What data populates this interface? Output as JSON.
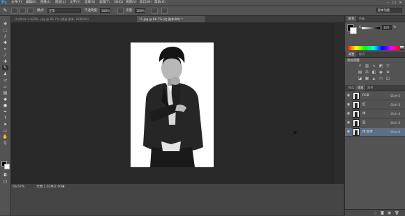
{
  "app": {
    "logo": "Ps"
  },
  "menu": {
    "items": [
      "文件(F)",
      "编辑(E)",
      "图像(I)",
      "图层(L)",
      "文字(Y)",
      "选择(S)",
      "滤镜(T)",
      "3D(D)",
      "视图(V)",
      "窗口(W)",
      "帮助(H)"
    ],
    "window_controls": [
      "–",
      "□",
      "✕"
    ]
  },
  "options_bar": {
    "mode_label": "模式:",
    "mode_value": "正常",
    "opacity_label": "不透明度:",
    "opacity_value": "100%",
    "flow_label": "流量:",
    "flow_value": "100%",
    "workspace_value": "基本功能"
  },
  "document_tabs": [
    {
      "label": "Untitled-1-9ZZ6...jpg @ 66.7% (通道 副本, RGB/8#)",
      "active": false
    },
    {
      "label": "11.jpg @ 66.7% (红 副本/8#) *",
      "active": true
    }
  ],
  "status": {
    "zoom": "66.67%",
    "doc_size": "文档:1.02M/2.40M"
  },
  "panels": {
    "color_tabs": [
      "颜色",
      "色板"
    ],
    "color_slider_label": "K",
    "color_value": "100",
    "color_unit": "%",
    "adjust_tabs": [
      "调整",
      "样式"
    ],
    "adjust_title": "添加调整",
    "layer_tabs": [
      "图层",
      "通道",
      "路径"
    ],
    "channels": [
      {
        "name": "RGB",
        "shortcut": "Ctrl+2",
        "selected": false
      },
      {
        "name": "红",
        "shortcut": "Ctrl+3",
        "selected": false
      },
      {
        "name": "绿",
        "shortcut": "Ctrl+4",
        "selected": false
      },
      {
        "name": "蓝",
        "shortcut": "Ctrl+5",
        "selected": false
      },
      {
        "name": "绿 副本",
        "shortcut": "Ctrl+6",
        "selected": true
      }
    ]
  },
  "colors": {
    "accent": "#33a5ff",
    "selected_row": "#5c6f87"
  }
}
